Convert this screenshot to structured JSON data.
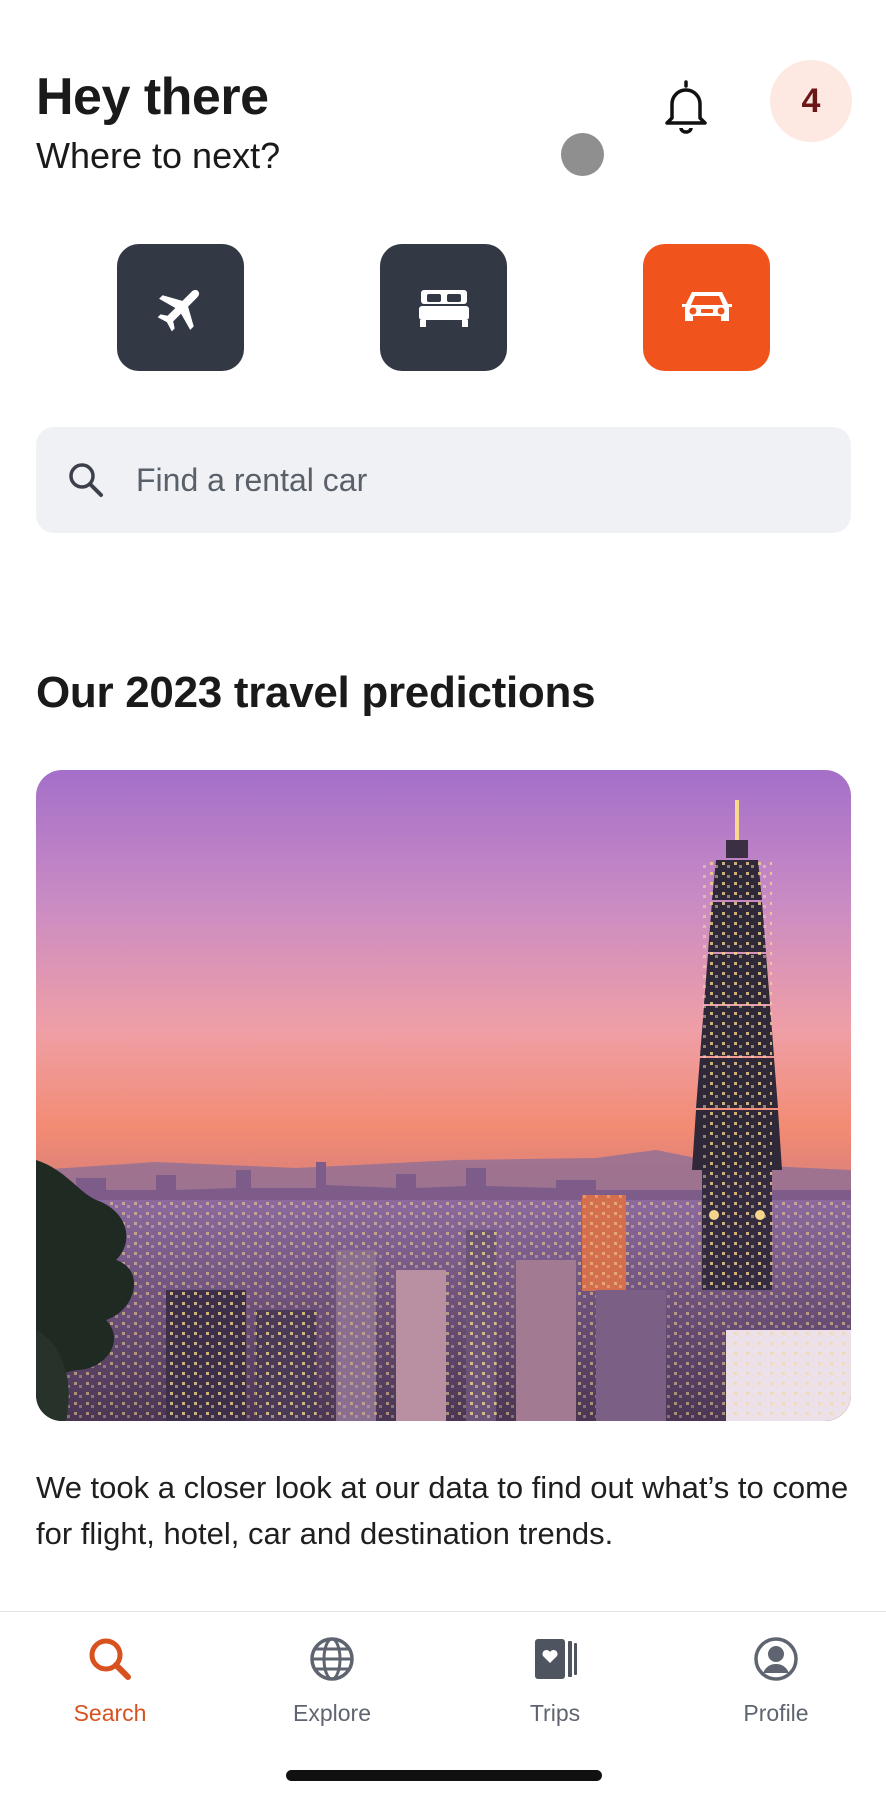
{
  "header": {
    "greeting": "Hey there",
    "subtitle": "Where to next?",
    "notification_count": "4"
  },
  "categories": [
    {
      "name": "flights",
      "icon": "airplane-icon",
      "active": false
    },
    {
      "name": "stays",
      "icon": "bed-icon",
      "active": false
    },
    {
      "name": "cars",
      "icon": "car-icon",
      "active": true
    }
  ],
  "search": {
    "placeholder": "Find a rental car",
    "value": ""
  },
  "feature": {
    "title": "Our 2023 travel predictions",
    "image": "city-skyline-at-sunset",
    "description": "We took a closer look at our data to find out what’s to come for flight, hotel, car and destination trends."
  },
  "tabs": [
    {
      "label": "Search",
      "icon": "search-icon",
      "active": true
    },
    {
      "label": "Explore",
      "icon": "globe-icon",
      "active": false
    },
    {
      "label": "Trips",
      "icon": "trips-icon",
      "active": false
    },
    {
      "label": "Profile",
      "icon": "profile-icon",
      "active": false
    }
  ],
  "colors": {
    "accent": "#f0541c",
    "dark_button": "#323844",
    "search_bg": "#eff1f4",
    "avatar_bg": "#fde9e1",
    "active_tab": "#d8521f"
  }
}
